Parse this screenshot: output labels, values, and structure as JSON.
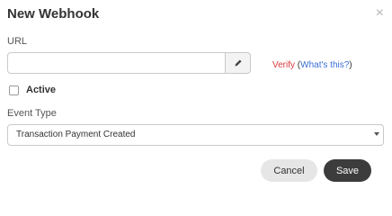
{
  "dialog": {
    "title": "New Webhook",
    "close_symbol": "×"
  },
  "url_field": {
    "label": "URL",
    "value": "",
    "placeholder": "",
    "edit_icon": "pencil-icon"
  },
  "verify": {
    "verify_label": "Verify",
    "open_paren": "(",
    "whats_this_label": "What's this?",
    "close_paren": ")"
  },
  "active": {
    "label": "Active",
    "checked": false
  },
  "event_type": {
    "label": "Event Type",
    "selected": "Transaction Payment Created"
  },
  "actions": {
    "cancel_label": "Cancel",
    "save_label": "Save"
  },
  "colors": {
    "verify": "#d9393e",
    "link": "#3a6fd8",
    "save_bg": "#3c3c3c",
    "cancel_bg": "#e6e6e6"
  }
}
